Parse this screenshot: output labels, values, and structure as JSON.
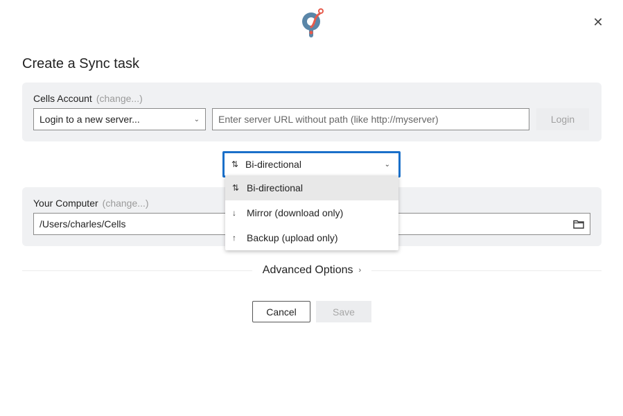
{
  "app": {
    "logo_name": "pydio-cells-logo",
    "close_icon": "close-icon"
  },
  "title": "Create a Sync task",
  "account": {
    "label": "Cells Account",
    "change_label": "(change...)",
    "server_select": "Login to a new server...",
    "url_placeholder": "Enter server URL without path (like http://myserver)",
    "login_label": "Login"
  },
  "direction": {
    "selected": "Bi-directional",
    "options": [
      {
        "label": "Bi-directional",
        "icon": "↑↓"
      },
      {
        "label": "Mirror (download only)",
        "icon": "↓"
      },
      {
        "label": "Backup (upload only)",
        "icon": "↑"
      }
    ]
  },
  "computer": {
    "label": "Your Computer",
    "change_label": "(change...)",
    "path": "/Users/charles/Cells"
  },
  "advanced_label": "Advanced Options",
  "buttons": {
    "cancel": "Cancel",
    "save": "Save"
  },
  "colors": {
    "accent": "#1a6fc9",
    "logo_blue": "#5a86a8",
    "logo_red": "#e65a4b",
    "panel_bg": "#f0f1f3"
  }
}
